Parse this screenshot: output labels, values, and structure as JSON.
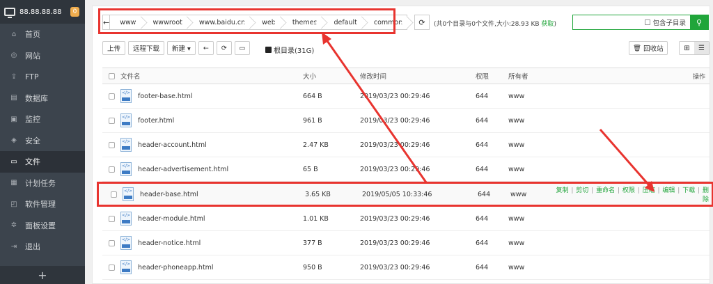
{
  "sidebar": {
    "server_ip": "88.88.88.88",
    "badge": "0",
    "items": [
      {
        "label": "首页",
        "icon": "home-icon",
        "glyph": "⌂"
      },
      {
        "label": "网站",
        "icon": "globe-icon",
        "glyph": "◎"
      },
      {
        "label": "FTP",
        "icon": "ftp-icon",
        "glyph": "⇪"
      },
      {
        "label": "数据库",
        "icon": "database-icon",
        "glyph": "▤"
      },
      {
        "label": "监控",
        "icon": "monitor-icon",
        "glyph": "▣"
      },
      {
        "label": "安全",
        "icon": "shield-icon",
        "glyph": "◈"
      },
      {
        "label": "文件",
        "icon": "folder-icon",
        "glyph": "▭"
      },
      {
        "label": "计划任务",
        "icon": "calendar-icon",
        "glyph": "▦"
      },
      {
        "label": "软件管理",
        "icon": "apps-icon",
        "glyph": "◰"
      },
      {
        "label": "面板设置",
        "icon": "gear-icon",
        "glyph": "✲"
      },
      {
        "label": "退出",
        "icon": "logout-icon",
        "glyph": "⇥"
      }
    ],
    "add_label": "+"
  },
  "path": {
    "back_glyph": "←",
    "crumbs": [
      "www",
      "wwwroot",
      "www.baidu.cn",
      "web",
      "themes",
      "default",
      "common"
    ],
    "refresh_glyph": "⟳"
  },
  "summary": {
    "text": "(共0个目录与0个文件,大小:28.93 KB ",
    "fetch": "获取",
    "close": ")"
  },
  "search": {
    "include_sub": "包含子目录",
    "button_glyph": "⚲"
  },
  "toolbar": {
    "upload": "上传",
    "remote_download": "远程下载",
    "new": "新建 ▾",
    "back_glyph": "←",
    "refresh_glyph": "⟳",
    "terminal_glyph": "▭",
    "root_dir": "根目录(31G)",
    "recycle": "回收站",
    "grid_glyph": "⊞",
    "list_glyph": "☰"
  },
  "table": {
    "headers": {
      "name": "文件名",
      "size": "大小",
      "time": "修改时间",
      "perm": "权限",
      "owner": "所有者",
      "ops": "操作"
    },
    "rows": [
      {
        "name": "footer-base.html",
        "size": "664 B",
        "time": "2019/03/23 00:29:46",
        "perm": "644",
        "owner": "www"
      },
      {
        "name": "footer.html",
        "size": "961 B",
        "time": "2019/03/23 00:29:46",
        "perm": "644",
        "owner": "www"
      },
      {
        "name": "header-account.html",
        "size": "2.47 KB",
        "time": "2019/03/23 00:29:46",
        "perm": "644",
        "owner": "www"
      },
      {
        "name": "header-advertisement.html",
        "size": "65 B",
        "time": "2019/03/23 00:29:46",
        "perm": "644",
        "owner": "www"
      },
      {
        "name": "header-base.html",
        "size": "3.65 KB",
        "time": "2019/05/05 10:33:46",
        "perm": "644",
        "owner": "www"
      },
      {
        "name": "header-module.html",
        "size": "1.01 KB",
        "time": "2019/03/23 00:29:46",
        "perm": "644",
        "owner": "www"
      },
      {
        "name": "header-notice.html",
        "size": "377 B",
        "time": "2019/03/23 00:29:46",
        "perm": "644",
        "owner": "www"
      },
      {
        "name": "header-phoneapp.html",
        "size": "950 B",
        "time": "2019/03/23 00:29:46",
        "perm": "644",
        "owner": "www"
      }
    ],
    "ops": [
      "复制",
      "剪切",
      "重命名",
      "权限",
      "压缩",
      "编辑",
      "下载",
      "删除"
    ]
  },
  "colors": {
    "accent": "#20a53a",
    "annotation": "#e8342f",
    "sidebar_bg": "#3c444d"
  }
}
